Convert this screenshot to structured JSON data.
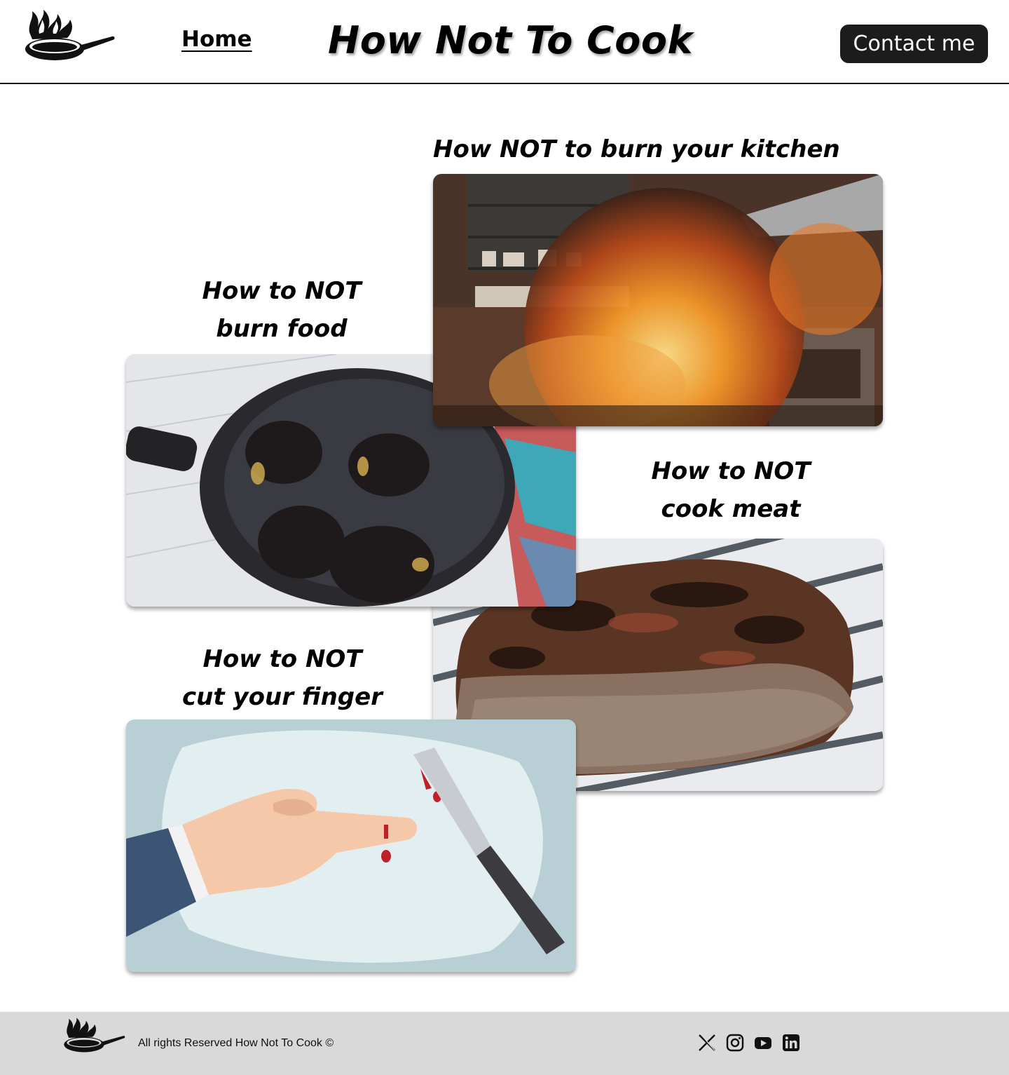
{
  "header": {
    "logo_icon": "flaming-pan-icon",
    "nav_home_label": "Home",
    "site_title": "How Not To Cook",
    "contact_label": "Contact me"
  },
  "cards": [
    {
      "title": "How NOT to burn your kitchen",
      "image": "kitchen-fire-image"
    },
    {
      "title": "How to NOT burn food",
      "image": "burnt-food-pan-image"
    },
    {
      "title": "How to NOT cook meat",
      "image": "overcooked-steak-image"
    },
    {
      "title": "How to NOT cut your finger",
      "image": "cut-finger-image"
    }
  ],
  "footer": {
    "copyright": "All rights Reserved How Not To Cook ©",
    "social_icons": [
      "x-icon",
      "instagram-icon",
      "youtube-icon",
      "linkedin-icon"
    ]
  },
  "colors": {
    "dark_button": "#1c1c1c",
    "footer_bg": "#d9d9d9"
  }
}
